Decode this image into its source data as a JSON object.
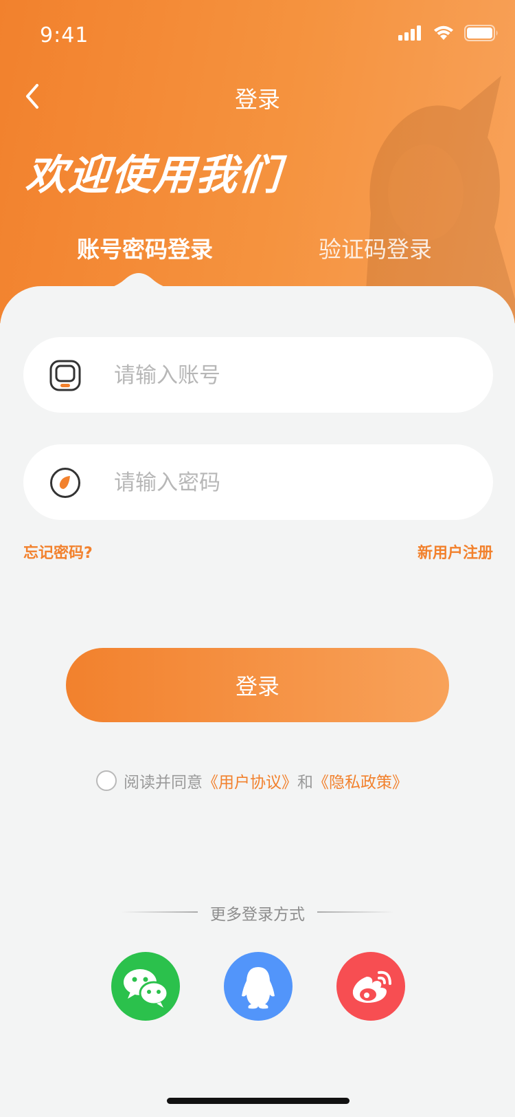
{
  "status_bar": {
    "time": "9:41"
  },
  "nav": {
    "title": "登录"
  },
  "hero": {
    "welcome": "欢迎使用我们"
  },
  "tabs": [
    {
      "label": "账号密码登录",
      "active": true
    },
    {
      "label": "验证码登录",
      "active": false
    }
  ],
  "form": {
    "account_placeholder": "请输入账号",
    "password_placeholder": "请输入密码",
    "forgot_password": "忘记密码?",
    "register": "新用户注册",
    "login_button": "登录"
  },
  "agreement": {
    "prefix": "阅读并同意",
    "user_agreement": "《用户协议》",
    "and": "和",
    "privacy_policy": "《隐私政策》"
  },
  "more_login": {
    "label": "更多登录方式",
    "options": [
      {
        "name": "wechat",
        "icon": "wechat-icon",
        "color": "#2bc14c"
      },
      {
        "name": "qq",
        "icon": "qq-icon",
        "color": "#5295fa"
      },
      {
        "name": "weibo",
        "icon": "weibo-icon",
        "color": "#f74e52"
      }
    ]
  },
  "colors": {
    "accent": "#f2812d",
    "background": "#f3f4f4"
  }
}
